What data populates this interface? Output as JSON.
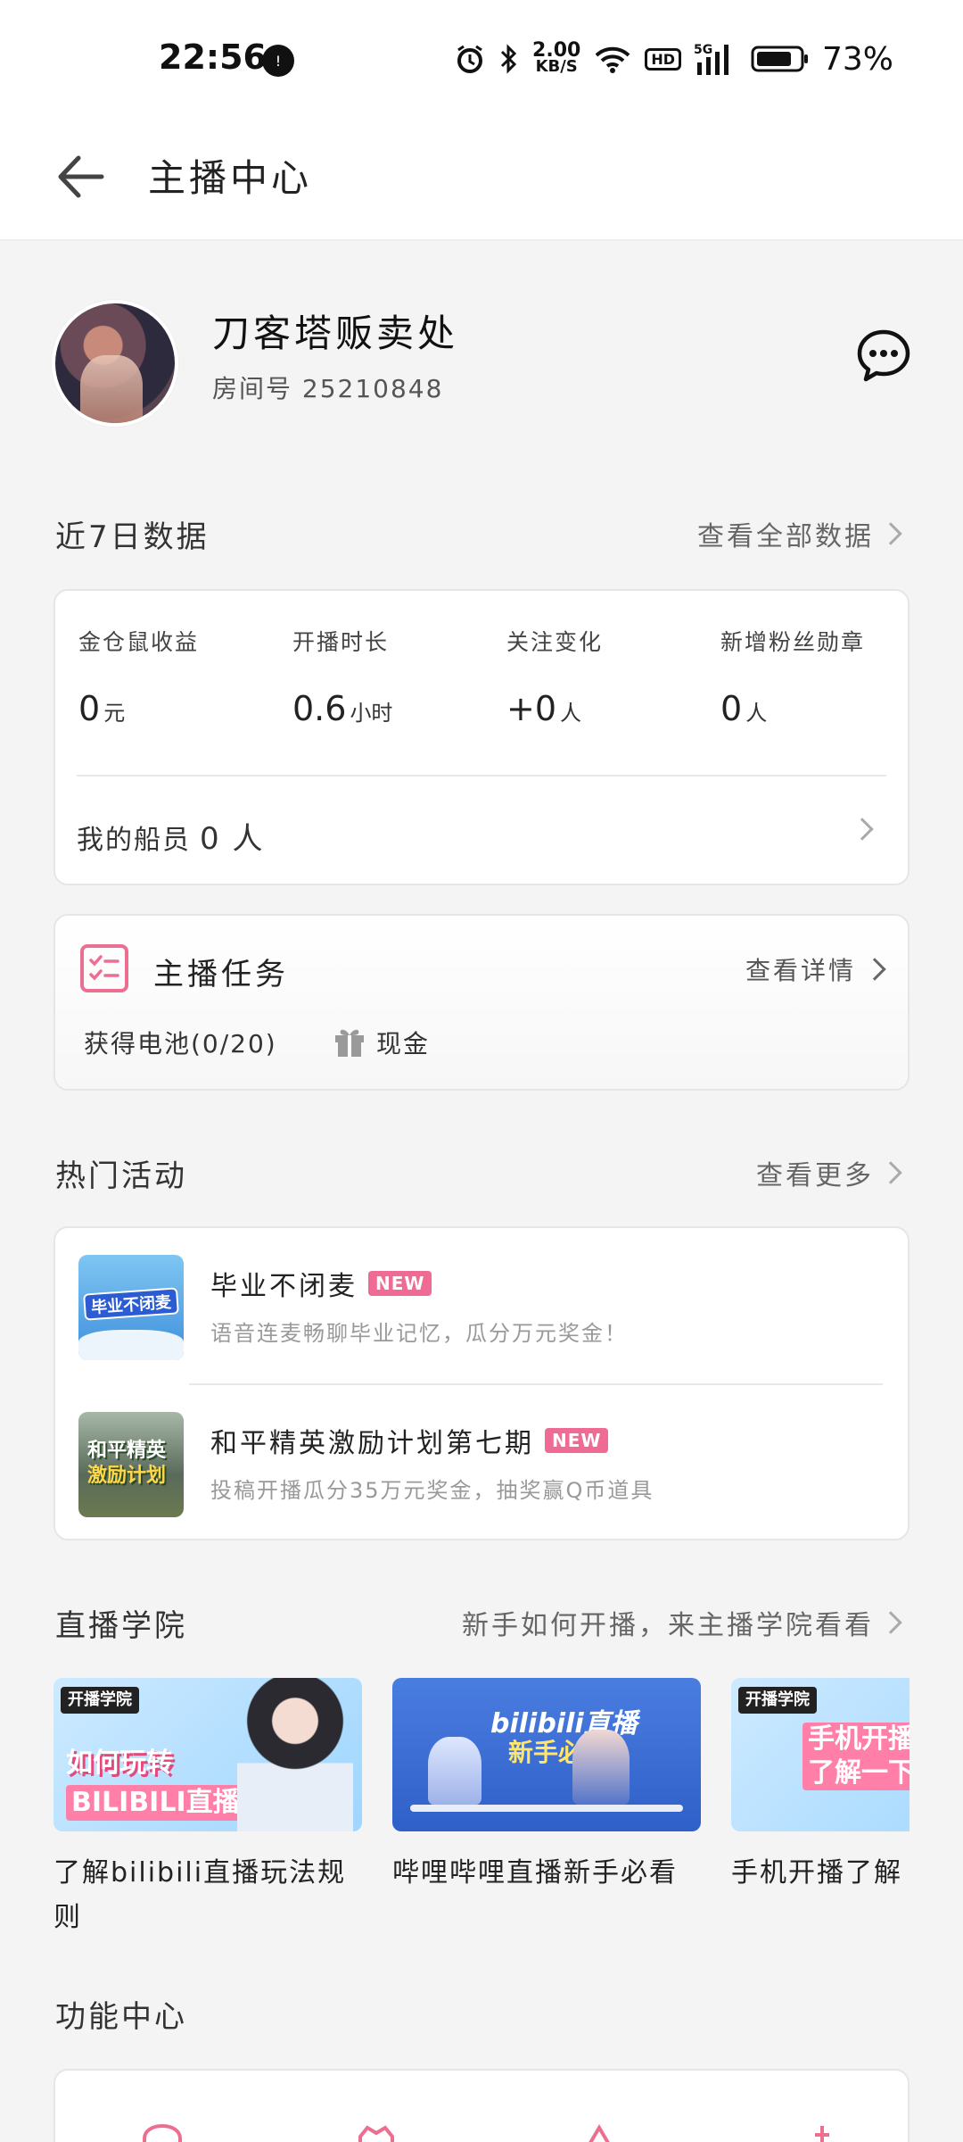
{
  "status_bar": {
    "time": "22:56",
    "notification": "!",
    "net_speed_value": "2.00",
    "net_speed_unit": "KB/S",
    "hd": "HD",
    "signal_label": "5G",
    "battery": "73%"
  },
  "header": {
    "title": "主播中心"
  },
  "profile": {
    "name": "刀客塔贩卖处",
    "room": "房间号 25210848"
  },
  "recent_data": {
    "title": "近7日数据",
    "link": "查看全部数据",
    "stats": [
      {
        "label": "金仓鼠收益",
        "value": "0",
        "unit": "元"
      },
      {
        "label": "开播时长",
        "value": "0.6",
        "unit": "小时"
      },
      {
        "label": "关注变化",
        "value": "+0",
        "unit": "人"
      },
      {
        "label": "新增粉丝勋章",
        "value": "0",
        "unit": "人"
      }
    ],
    "crew_label": "我的船员",
    "crew_count": "0 人"
  },
  "tasks": {
    "title": "主播任务",
    "link": "查看详情",
    "battery": "获得电池(0/20)",
    "cash": "现金"
  },
  "events": {
    "title": "热门活动",
    "link": "查看更多",
    "items": [
      {
        "title": "毕业不闭麦",
        "badge": "NEW",
        "desc": "语音连麦畅聊毕业记忆，瓜分万元奖金！",
        "thumb_text": "毕业不闭麦"
      },
      {
        "title": "和平精英激励计划第七期",
        "badge": "NEW",
        "desc": "投稿开播瓜分35万元奖金，抽奖赢Q币道具",
        "thumb_line1": "和平精英",
        "thumb_line2": "激励计划"
      }
    ]
  },
  "academy": {
    "title": "直播学院",
    "link": "新手如何开播，来主播学院看看",
    "items": [
      {
        "caption": "了解bilibili直播玩法规则",
        "logo": "开播学院",
        "big1": "如何玩转",
        "big2": "BILIBILI直播"
      },
      {
        "caption": "哔哩哔哩直播新手必看",
        "brand": "bilibili直播",
        "brand2": "新手必看"
      },
      {
        "caption": "手机开播了解",
        "logo": "开播学院",
        "big1": "手机开播",
        "big2": "了解一下"
      }
    ]
  },
  "functions": {
    "title": "功能中心"
  },
  "colors": {
    "accent_pink": "#ec6f92",
    "background": "#f4f4f4",
    "card": "#ffffff"
  }
}
